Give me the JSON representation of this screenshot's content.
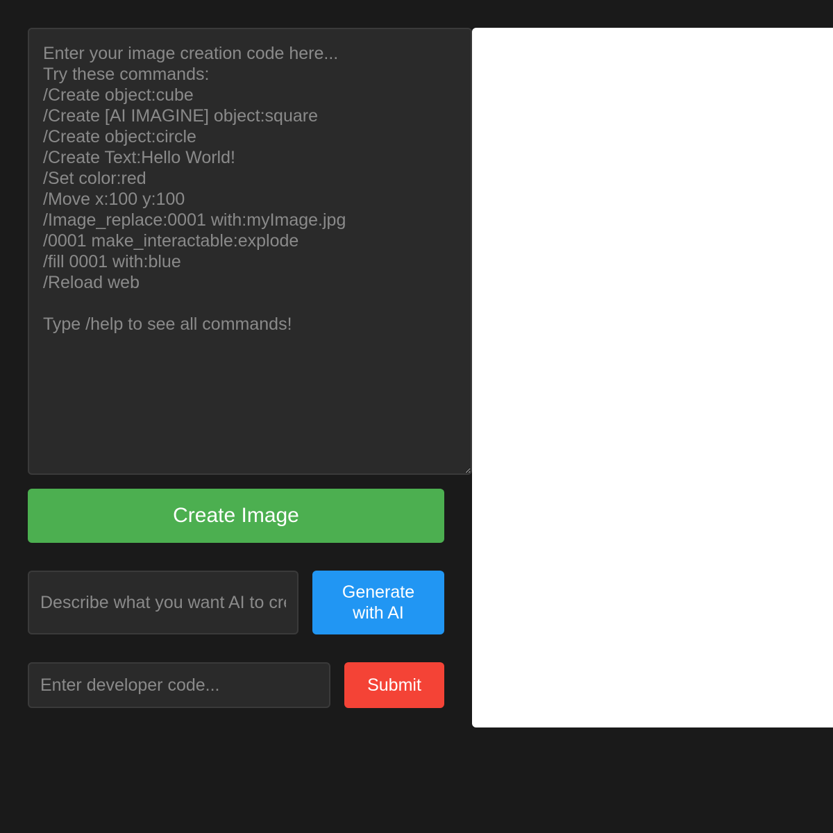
{
  "editor": {
    "placeholder": "Enter your image creation code here...\nTry these commands:\n/Create object:cube\n/Create [AI IMAGINE] object:square\n/Create object:circle\n/Create Text:Hello World!\n/Set color:red\n/Move x:100 y:100\n/Image_replace:0001 with:myImage.jpg\n/0001 make_interactable:explode\n/fill 0001 with:blue\n/Reload web\n\nType /help to see all commands!",
    "value": ""
  },
  "create_button": {
    "label": "Create Image"
  },
  "ai": {
    "prompt_placeholder": "Describe what you want AI to create...",
    "prompt_value": "",
    "generate_label": "Generate with AI"
  },
  "developer": {
    "code_placeholder": "Enter developer code...",
    "code_value": "",
    "submit_label": "Submit"
  },
  "colors": {
    "background": "#1a1a1a",
    "create_button": "#4caf50",
    "generate_button": "#2196f3",
    "submit_button": "#f44336",
    "canvas": "#ffffff"
  }
}
